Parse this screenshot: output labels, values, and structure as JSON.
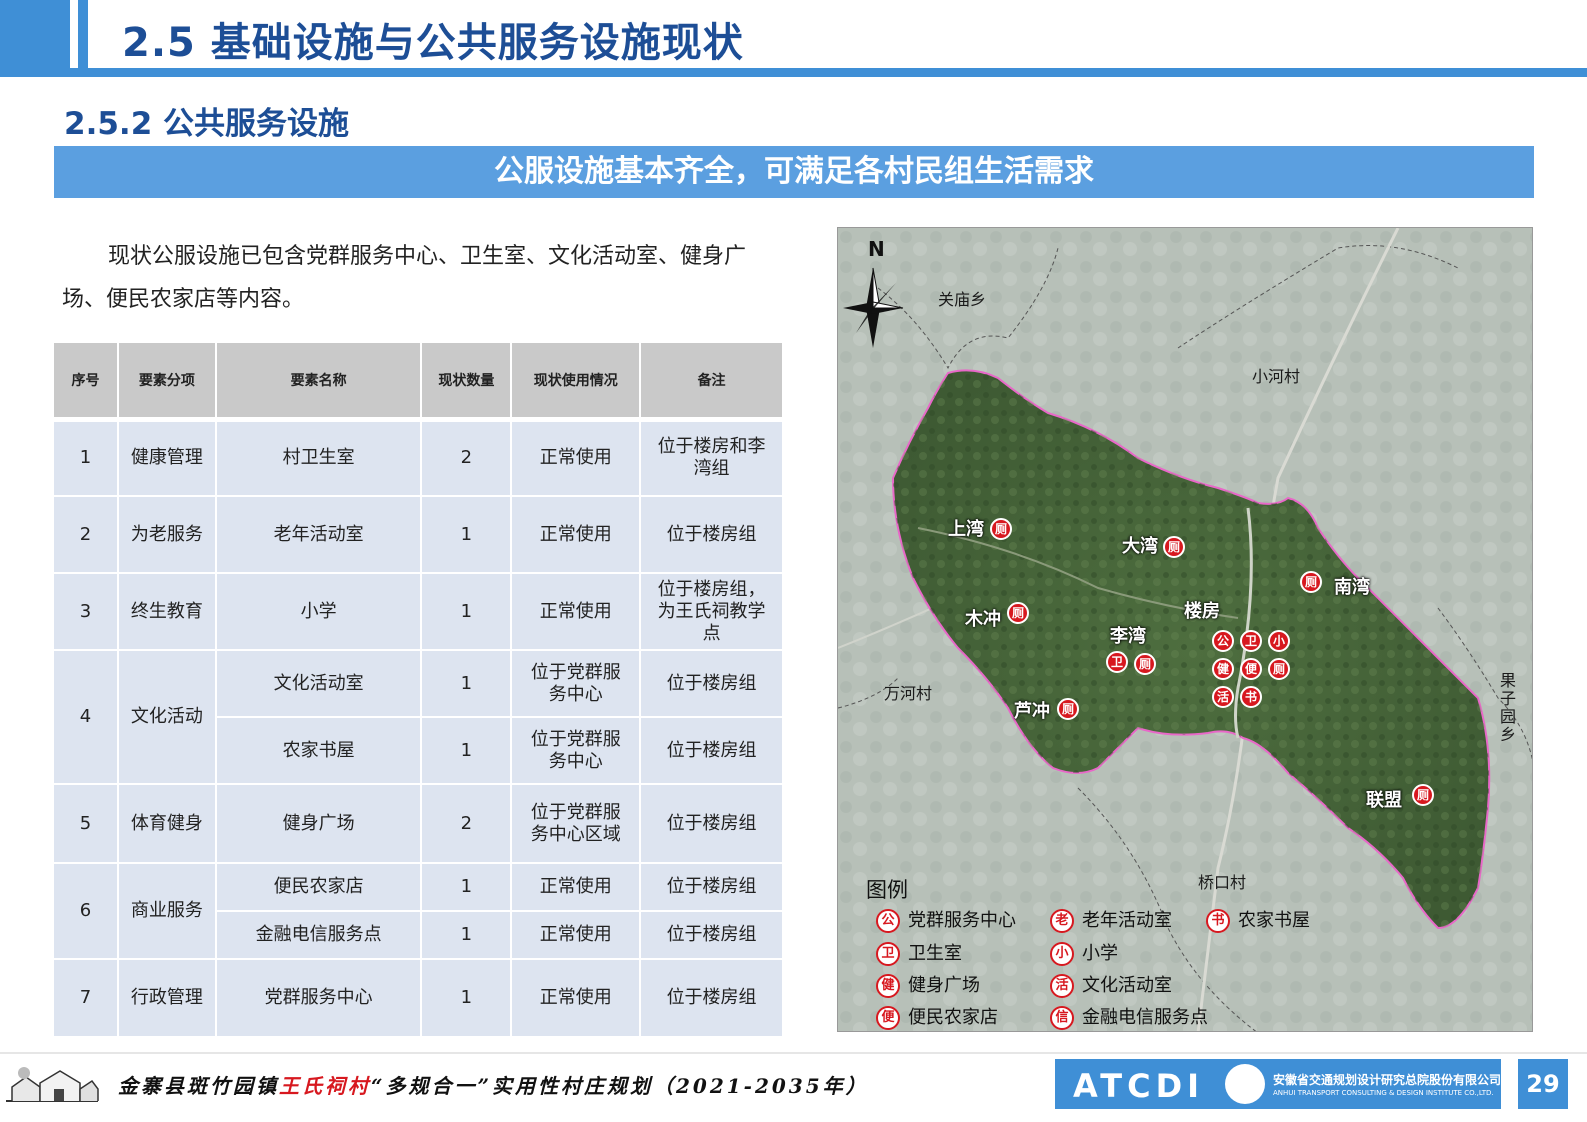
{
  "header": {
    "main_title": "2.5 基础设施与公共服务设施现状",
    "section_title": "2.5.2 公共服务设施",
    "banner": "公服设施基本齐全，可满足各村民组生活需求"
  },
  "intro_text": "现状公服设施已包含党群服务中心、卫生室、文化活动室、健身广场、便民农家店等内容。",
  "table": {
    "headers": [
      "序号",
      "要素分项",
      "要素名称",
      "现状数量",
      "现状使用情况",
      "备注"
    ],
    "rows": [
      {
        "no": "1",
        "category": "健康管理",
        "name": "村卫生室",
        "qty": "2",
        "status": "正常使用",
        "note": "位于楼房和李湾组"
      },
      {
        "no": "2",
        "category": "为老服务",
        "name": "老年活动室",
        "qty": "1",
        "status": "正常使用",
        "note": "位于楼房组"
      },
      {
        "no": "3",
        "category": "终生教育",
        "name": "小学",
        "qty": "1",
        "status": "正常使用",
        "note": "位于楼房组，为王氏祠教学点"
      },
      {
        "no": "4",
        "category": "文化活动",
        "name": "文化活动室",
        "qty": "1",
        "status": "位于党群服务中心",
        "note": "位于楼房组"
      },
      {
        "no": "",
        "category": "",
        "name": "农家书屋",
        "qty": "1",
        "status": "位于党群服务中心",
        "note": "位于楼房组"
      },
      {
        "no": "5",
        "category": "体育健身",
        "name": "健身广场",
        "qty": "2",
        "status": "位于党群服务中心区域",
        "note": "位于楼房组"
      },
      {
        "no": "6",
        "category": "商业服务",
        "name": "便民农家店",
        "qty": "1",
        "status": "正常使用",
        "note": "位于楼房组"
      },
      {
        "no": "",
        "category": "",
        "name": "金融电信服务点",
        "qty": "1",
        "status": "正常使用",
        "note": "位于楼房组"
      },
      {
        "no": "7",
        "category": "行政管理",
        "name": "党群服务中心",
        "qty": "1",
        "status": "正常使用",
        "note": "位于楼房组"
      }
    ]
  },
  "map": {
    "north": "N",
    "surrounding": [
      "关庙乡",
      "小河村",
      "万河村",
      "果子园乡",
      "桥口村"
    ],
    "villages": [
      "上湾",
      "大湾",
      "南湾",
      "木冲",
      "楼房",
      "李湾",
      "芦冲",
      "联盟"
    ],
    "icon_chars": {
      "toilet": "厕",
      "public": "公",
      "clinic": "卫",
      "school": "小",
      "fitness": "健",
      "store": "便",
      "activity": "活",
      "book": "书"
    },
    "legend_title": "图例",
    "legend": [
      {
        "icon": "公",
        "label": "党群服务中心"
      },
      {
        "icon": "老",
        "label": "老年活动室"
      },
      {
        "icon": "书",
        "label": "农家书屋"
      },
      {
        "icon": "卫",
        "label": "卫生室"
      },
      {
        "icon": "小",
        "label": "小学"
      },
      {
        "icon": "健",
        "label": "健身广场"
      },
      {
        "icon": "活",
        "label": "文化活动室"
      },
      {
        "icon": "便",
        "label": "便民农家店"
      },
      {
        "icon": "信",
        "label": "金融电信服务点"
      }
    ]
  },
  "footer": {
    "title_pre": "金寨县斑竹园镇",
    "title_red": "王氏祠村",
    "title_post": "“多规合一”实用性村庄规划（2021-2035年）",
    "org_logo": "ATCDI",
    "org_cn": "安徽省交通规划设计研究总院股份有限公司",
    "org_en": "ANHUI TRANSPORT CONSULTING & DESIGN INSTITUTE CO.,LTD.",
    "page": "29"
  },
  "colors": {
    "accent": "#3f8fd6",
    "title": "#1d4e96",
    "marker": "#d7181f",
    "boundary": "#e868c8"
  }
}
